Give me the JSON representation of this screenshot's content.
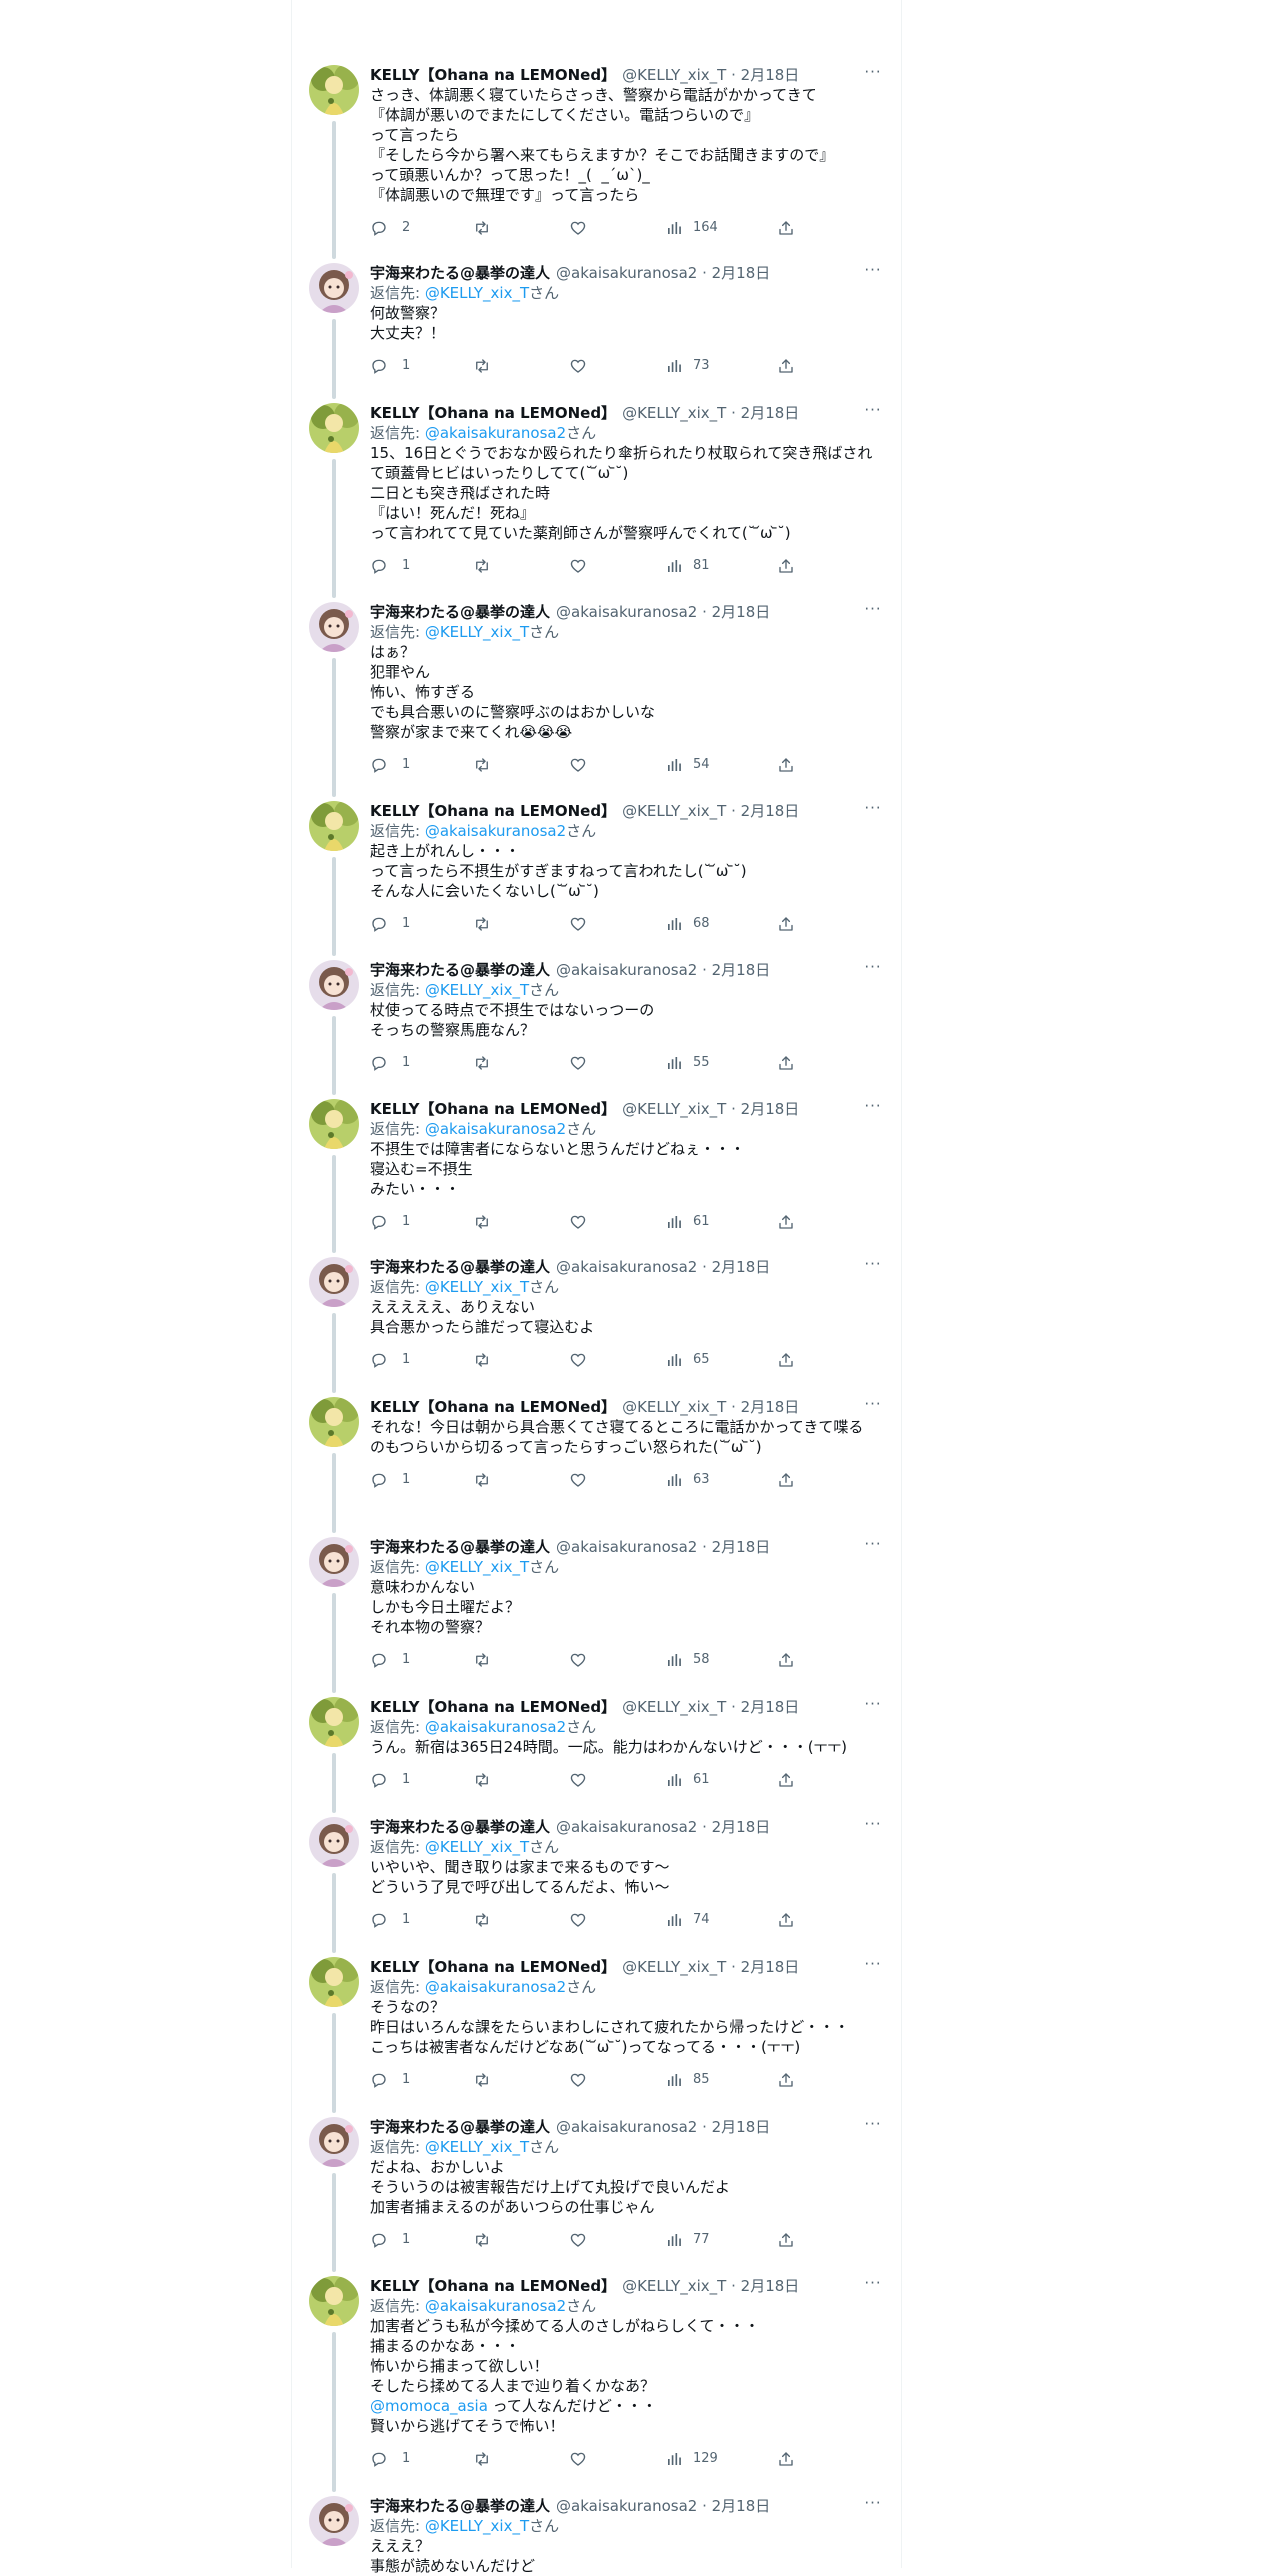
{
  "reply_label": "返信先: ",
  "reply_suffix": "さん",
  "more_label": "···",
  "tweets": [
    {
      "name": "KELLY【Ohana na LEMONed】",
      "handle": "@KELLY_xix_T · 2月18日",
      "reply_to": null,
      "lines": [
        "さっき、体調悪く寝ていたらさっき、警察から電話がかかってきて",
        "『体調が悪いのでまたにしてください。電話つらいので』",
        "って言ったら",
        "『そしたら今から署へ来てもらえますか？そこでお話聞きますので』",
        "って頭悪いんか？って思った！_(  _´ω`)_",
        "『体調悪いので無理です』って言ったら"
      ],
      "stats": {
        "replies": "2",
        "retweets": "",
        "likes": "",
        "views": "164"
      }
    },
    {
      "name": "宇海来わたる@暴挙の達人",
      "handle": "@akaisakuranosa2 · 2月18日",
      "reply_to": "@KELLY_xix_T",
      "lines": [
        "何故警察？",
        "大丈夫？！"
      ],
      "stats": {
        "replies": "1",
        "retweets": "",
        "likes": "",
        "views": "73"
      }
    },
    {
      "name": "KELLY【Ohana na LEMONed】",
      "handle": "@KELLY_xix_T · 2月18日",
      "reply_to": "@akaisakuranosa2",
      "lines": [
        "15、16日とぐうでおなか殴られたり傘折られたり杖取られて突き飛ばされ",
        "て頭蓋骨ヒビはいったりしてて(˘ ᷄ω ᷅˘)",
        "二日とも突き飛ばされた時",
        "『はい！死んだ！死ね』",
        "って言われてて見ていた薬剤師さんが警察呼んでくれて(˘ ᷄ω ᷅˘)"
      ],
      "stats": {
        "replies": "1",
        "retweets": "",
        "likes": "",
        "views": "81"
      }
    },
    {
      "name": "宇海来わたる@暴挙の達人",
      "handle": "@akaisakuranosa2 · 2月18日",
      "reply_to": "@KELLY_xix_T",
      "lines": [
        "はぁ？",
        "犯罪やん",
        "怖い、怖すぎる",
        "でも具合悪いのに警察呼ぶのはおかしいな",
        "警察が家まで来てくれ😭😭😭"
      ],
      "stats": {
        "replies": "1",
        "retweets": "",
        "likes": "",
        "views": "54"
      }
    },
    {
      "name": "KELLY【Ohana na LEMONed】",
      "handle": "@KELLY_xix_T · 2月18日",
      "reply_to": "@akaisakuranosa2",
      "lines": [
        "起き上がれんし・・・",
        "って言ったら不摂生がすぎますねって言われたし(˘ ᷄ω ᷅˘)",
        "そんな人に会いたくないし(˘ ᷄ω ᷅˘)"
      ],
      "stats": {
        "replies": "1",
        "retweets": "",
        "likes": "",
        "views": "68"
      }
    },
    {
      "name": "宇海来わたる@暴挙の達人",
      "handle": "@akaisakuranosa2 · 2月18日",
      "reply_to": "@KELLY_xix_T",
      "lines": [
        "杖使ってる時点で不摂生ではないっつーの",
        "そっちの警察馬鹿なん？"
      ],
      "stats": {
        "replies": "1",
        "retweets": "",
        "likes": "",
        "views": "55"
      }
    },
    {
      "name": "KELLY【Ohana na LEMONed】",
      "handle": "@KELLY_xix_T · 2月18日",
      "reply_to": "@akaisakuranosa2",
      "lines": [
        "不摂生では障害者にならないと思うんだけどねぇ・・・",
        "寝込む=不摂生",
        "みたい・・・"
      ],
      "stats": {
        "replies": "1",
        "retweets": "",
        "likes": "",
        "views": "61"
      }
    },
    {
      "name": "宇海来わたる@暴挙の達人",
      "handle": "@akaisakuranosa2 · 2月18日",
      "reply_to": "@KELLY_xix_T",
      "lines": [
        "えええええ、ありえない",
        "具合悪かったら誰だって寝込むよ"
      ],
      "stats": {
        "replies": "1",
        "retweets": "",
        "likes": "",
        "views": "65"
      }
    },
    {
      "name": "KELLY【Ohana na LEMONed】",
      "handle": "@KELLY_xix_T · 2月18日",
      "reply_to": null,
      "lines": [
        "それな！今日は朝から具合悪くてさ寝てるところに電話かかってきて喋る",
        "のもつらいから切るって言ったらすっごい怒られた(˘ ᷄ω ᷅˘)"
      ],
      "stats": {
        "replies": "1",
        "retweets": "",
        "likes": "",
        "views": "63"
      }
    },
    {
      "name": "宇海来わたる@暴挙の達人",
      "handle": "@akaisakuranosa2 · 2月18日",
      "reply_to": "@KELLY_xix_T",
      "lines": [
        "意味わかんない",
        "しかも今日土曜だよ？",
        "それ本物の警察？"
      ],
      "stats": {
        "replies": "1",
        "retweets": "",
        "likes": "",
        "views": "58"
      }
    },
    {
      "name": "KELLY【Ohana na LEMONed】",
      "handle": "@KELLY_xix_T · 2月18日",
      "reply_to": "@akaisakuranosa2",
      "lines": [
        "うん。新宿は365日24時間。一応。能力はわかんないけど・・・(ㅜㅜ)"
      ],
      "stats": {
        "replies": "1",
        "retweets": "",
        "likes": "",
        "views": "61"
      }
    },
    {
      "name": "宇海来わたる@暴挙の達人",
      "handle": "@akaisakuranosa2 · 2月18日",
      "reply_to": "@KELLY_xix_T",
      "lines": [
        "いやいや、聞き取りは家まで来るものです〜",
        "どういう了見で呼び出してるんだよ、怖い〜"
      ],
      "stats": {
        "replies": "1",
        "retweets": "",
        "likes": "",
        "views": "74"
      }
    },
    {
      "name": "KELLY【Ohana na LEMONed】",
      "handle": "@KELLY_xix_T · 2月18日",
      "reply_to": "@akaisakuranosa2",
      "lines": [
        "そうなの？",
        "昨日はいろんな課をたらいまわしにされて疲れたから帰ったけど・・・",
        "こっちは被害者なんだけどなあ(˘ ᷄ω ᷅˘)ってなってる・・・(ㅜㅜ)"
      ],
      "stats": {
        "replies": "1",
        "retweets": "",
        "likes": "",
        "views": "85"
      }
    },
    {
      "name": "宇海来わたる@暴挙の達人",
      "handle": "@akaisakuranosa2 · 2月18日",
      "reply_to": "@KELLY_xix_T",
      "lines": [
        "だよね、おかしいよ",
        "そういうのは被害報告だけ上げて丸投げで良いんだよ",
        "加害者捕まえるのがあいつらの仕事じゃん"
      ],
      "stats": {
        "replies": "1",
        "retweets": "",
        "likes": "",
        "views": "77"
      }
    },
    {
      "name": "KELLY【Ohana na LEMONed】",
      "handle": "@KELLY_xix_T · 2月18日",
      "reply_to": "@akaisakuranosa2",
      "lines": [
        "加害者どうも私が今揉めてる人のさしがねらしくて・・・",
        "捕まるのかなあ・・・",
        "怖いから捕まって欲しい！",
        "そしたら揉めてる人まで辿り着くかなあ？",
        "@momoca_asia って人なんだけど・・・",
        "賢いから逃げてそうで怖い！"
      ],
      "mention_line": 4,
      "stats": {
        "replies": "1",
        "retweets": "",
        "likes": "",
        "views": "129"
      }
    },
    {
      "name": "宇海来わたる@暴挙の達人",
      "handle": "@akaisakuranosa2 · 2月18日",
      "reply_to": "@KELLY_xix_T",
      "lines": [
        "えええ？",
        "事態が読めないんだけど"
      ],
      "stats": {
        "replies": "",
        "retweets": "",
        "likes": "",
        "views": ""
      }
    }
  ]
}
